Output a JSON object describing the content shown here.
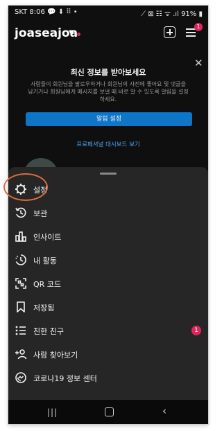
{
  "status_bar": {
    "carrier_time": "SKT 8:06",
    "icons_left": "💬 ⬇ ⠿ •",
    "icons_right": "⟋ ⊠ ☷ ᯤ .ıl",
    "battery": "91%"
  },
  "header": {
    "username": "joaseajoa",
    "menu_badge": "1"
  },
  "notification_card": {
    "title": "최신 정보를 받아보세요",
    "body": "사람들이 회원님을 팔로우하거나 회원님의 사진에 좋아요 및 댓글을 남기거나 회원님에게 메시지를 보낼 때 바로 알 수 있도록 알림을 설정하세요.",
    "button": "알림 설정",
    "dashboard_link": "프로페셔널 대시보드 보기"
  },
  "menu": {
    "items": [
      {
        "label": "설정",
        "icon": "settings-gear-icon"
      },
      {
        "label": "보관",
        "icon": "archive-history-icon"
      },
      {
        "label": "인사이트",
        "icon": "insights-bars-icon"
      },
      {
        "label": "내 활동",
        "icon": "activity-clock-icon"
      },
      {
        "label": "QR 코드",
        "icon": "qr-code-icon"
      },
      {
        "label": "저장됨",
        "icon": "bookmark-icon"
      },
      {
        "label": "친한 친구",
        "icon": "close-friends-list-icon",
        "badge": "1"
      },
      {
        "label": "사람 찾아보기",
        "icon": "add-person-icon"
      },
      {
        "label": "코로나19 정보 센터",
        "icon": "covid-info-icon"
      }
    ]
  },
  "colors": {
    "background": "#0f0f0f",
    "sheet": "#262626",
    "accent_blue": "#0f75c7",
    "badge_red": "#e0245e",
    "highlight_orange": "#e06a3f"
  }
}
